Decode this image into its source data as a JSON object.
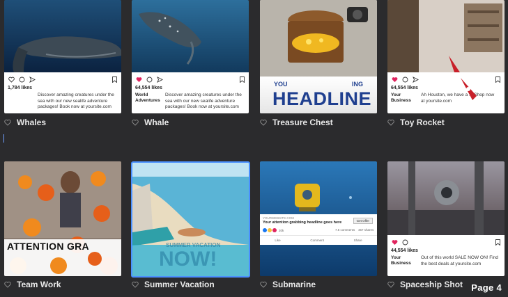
{
  "page_label": "Page 4",
  "cards": [
    {
      "title": "Whales",
      "likes": "1,784 likes",
      "account": "",
      "body": "Discover amazing creatures under the sea with our new sealife adventure packages! Book now at yoursite.com"
    },
    {
      "title": "Whale",
      "likes": "64,554 likes",
      "account": "World Adventures",
      "body": "Discover amazing creatures under the sea with our new sealife adventure packages! Book now at yoursite.com"
    },
    {
      "title": "Treasure Chest",
      "headline_small": "YOU",
      "headline_small_right": "ING",
      "headline": "HEADLINE"
    },
    {
      "title": "Toy Rocket",
      "likes": "64,554 likes",
      "account": "Your Business",
      "body": "Ah Houston, we have a ... Shop now at yoursite.com"
    },
    {
      "title": "Team Work",
      "headline": "ATTENTION GRA"
    },
    {
      "title": "Summer Vacation",
      "headline_small": "SUMMER VACATION",
      "headline": "NOW!"
    },
    {
      "title": "Submarine",
      "site": "YOURWEBSITE.COM",
      "fb_headline": "Your attention grabbing headline goes here",
      "cta": "Get Offer",
      "reactions": "20k",
      "comments": "7.5 comments",
      "shares": "457 shares",
      "like_label": "Like",
      "comment_label": "Comment",
      "share_label": "Share"
    },
    {
      "title": "Spaceship Shot",
      "likes": "44,554 likes",
      "account": "Your Business",
      "body": "Out of this world SALE NOW ON! Find the best deals at yoursite.com"
    }
  ],
  "colors": {
    "background": "#2b2b2d",
    "selected_border": "#4a90ff",
    "like_red": "#e0245e"
  }
}
